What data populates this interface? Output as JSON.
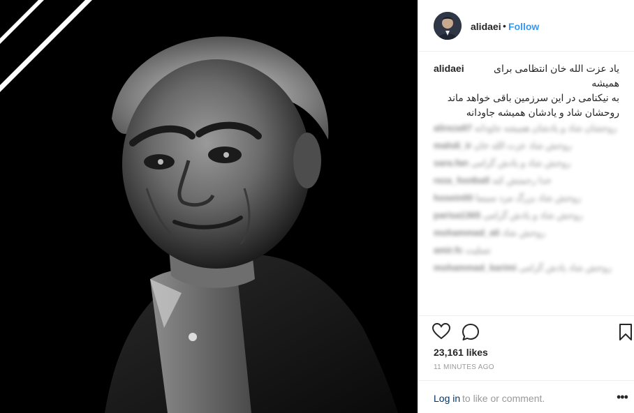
{
  "post": {
    "username": "alidaei",
    "separator": "•",
    "follow_label": "Follow",
    "caption_username": "alidaei",
    "caption_lines": [
      "یاد عزت الله خان انتظامی برای همیشه",
      "به نیکنامی در این سرزمین باقی خواهد ماند",
      "روحشان شاد و یادشان همیشه جاودانه"
    ],
    "likes": "23,161 likes",
    "time_ago": "11 MINUTES AGO",
    "login_link": "Log in",
    "login_suffix": "to like or comment.",
    "more_label": "•••"
  },
  "comments": [
    {
      "user": "alireza97",
      "text": "روحشان شاد و یادشان همیشه جاودانه"
    },
    {
      "user": "mahdi_ir",
      "text": "روحش شاد عزت الله خان"
    },
    {
      "user": "sara.fan",
      "text": "روحش شاد و یادش گرامی"
    },
    {
      "user": "reza_football",
      "text": "خدا رحمتش کند"
    },
    {
      "user": "hosein00",
      "text": "روحش شاد بزرگ مرد سینما"
    },
    {
      "user": "parisa1365",
      "text": "روحش شاد و یادش گرامی"
    },
    {
      "user": "mohammad_ali",
      "text": "روحش شاد"
    },
    {
      "user": "amir.fc",
      "text": "تسلیت"
    },
    {
      "user": "mohammad_karimi",
      "text": "روحش شاد یادش گرامی"
    }
  ],
  "colors": {
    "accent": "#3897f0",
    "link": "#003569",
    "muted": "#999999"
  },
  "icons": [
    "heart-icon",
    "comment-icon",
    "bookmark-icon",
    "more-options-icon"
  ]
}
